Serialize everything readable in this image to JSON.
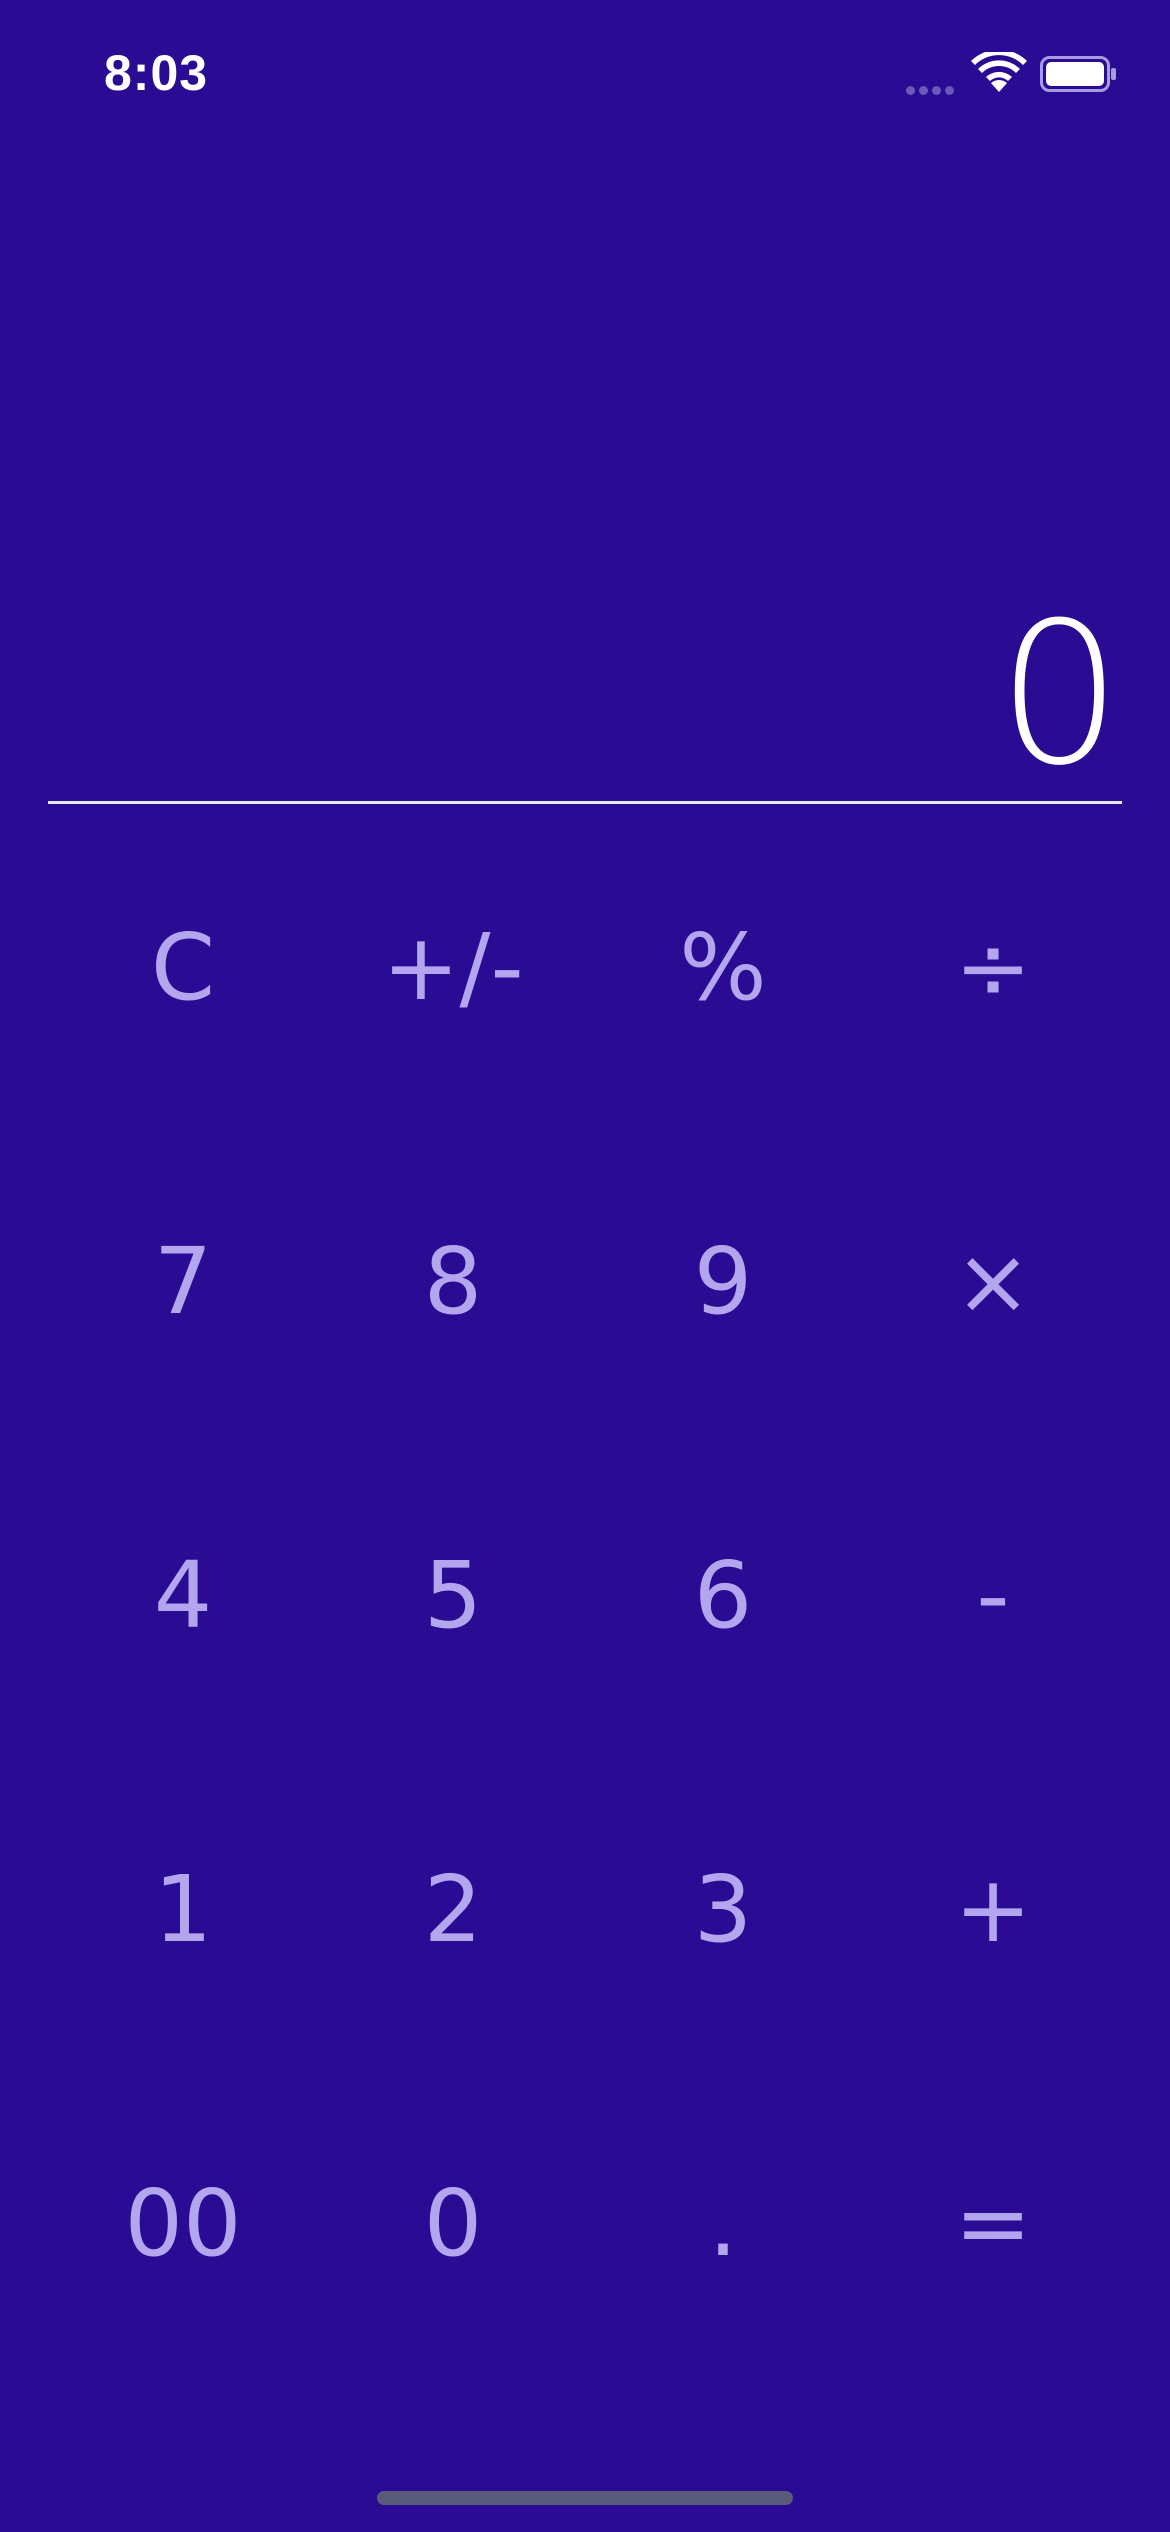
{
  "status_bar": {
    "time": "8:03",
    "wifi_icon": "wifi-icon",
    "battery_icon": "battery-full-icon"
  },
  "display": {
    "value": "0"
  },
  "keypad": {
    "rows": [
      [
        {
          "label": "C",
          "name": "clear-button"
        },
        {
          "label": "+/-",
          "name": "sign-toggle-button"
        },
        {
          "label": "%",
          "name": "percent-button"
        },
        {
          "label": "÷",
          "name": "divide-button"
        }
      ],
      [
        {
          "label": "7",
          "name": "digit-7-button"
        },
        {
          "label": "8",
          "name": "digit-8-button"
        },
        {
          "label": "9",
          "name": "digit-9-button"
        },
        {
          "label": "×",
          "name": "multiply-button"
        }
      ],
      [
        {
          "label": "4",
          "name": "digit-4-button"
        },
        {
          "label": "5",
          "name": "digit-5-button"
        },
        {
          "label": "6",
          "name": "digit-6-button"
        },
        {
          "label": "-",
          "name": "subtract-button"
        }
      ],
      [
        {
          "label": "1",
          "name": "digit-1-button"
        },
        {
          "label": "2",
          "name": "digit-2-button"
        },
        {
          "label": "3",
          "name": "digit-3-button"
        },
        {
          "label": "+",
          "name": "add-button"
        }
      ],
      [
        {
          "label": "00",
          "name": "double-zero-button"
        },
        {
          "label": "0",
          "name": "digit-0-button"
        },
        {
          "label": ".",
          "name": "decimal-button"
        },
        {
          "label": "=",
          "name": "equals-button"
        }
      ]
    ]
  },
  "colors": {
    "background": "#2a0b94",
    "key_text": "#b3a6ef",
    "display_text": "#ffffff"
  }
}
